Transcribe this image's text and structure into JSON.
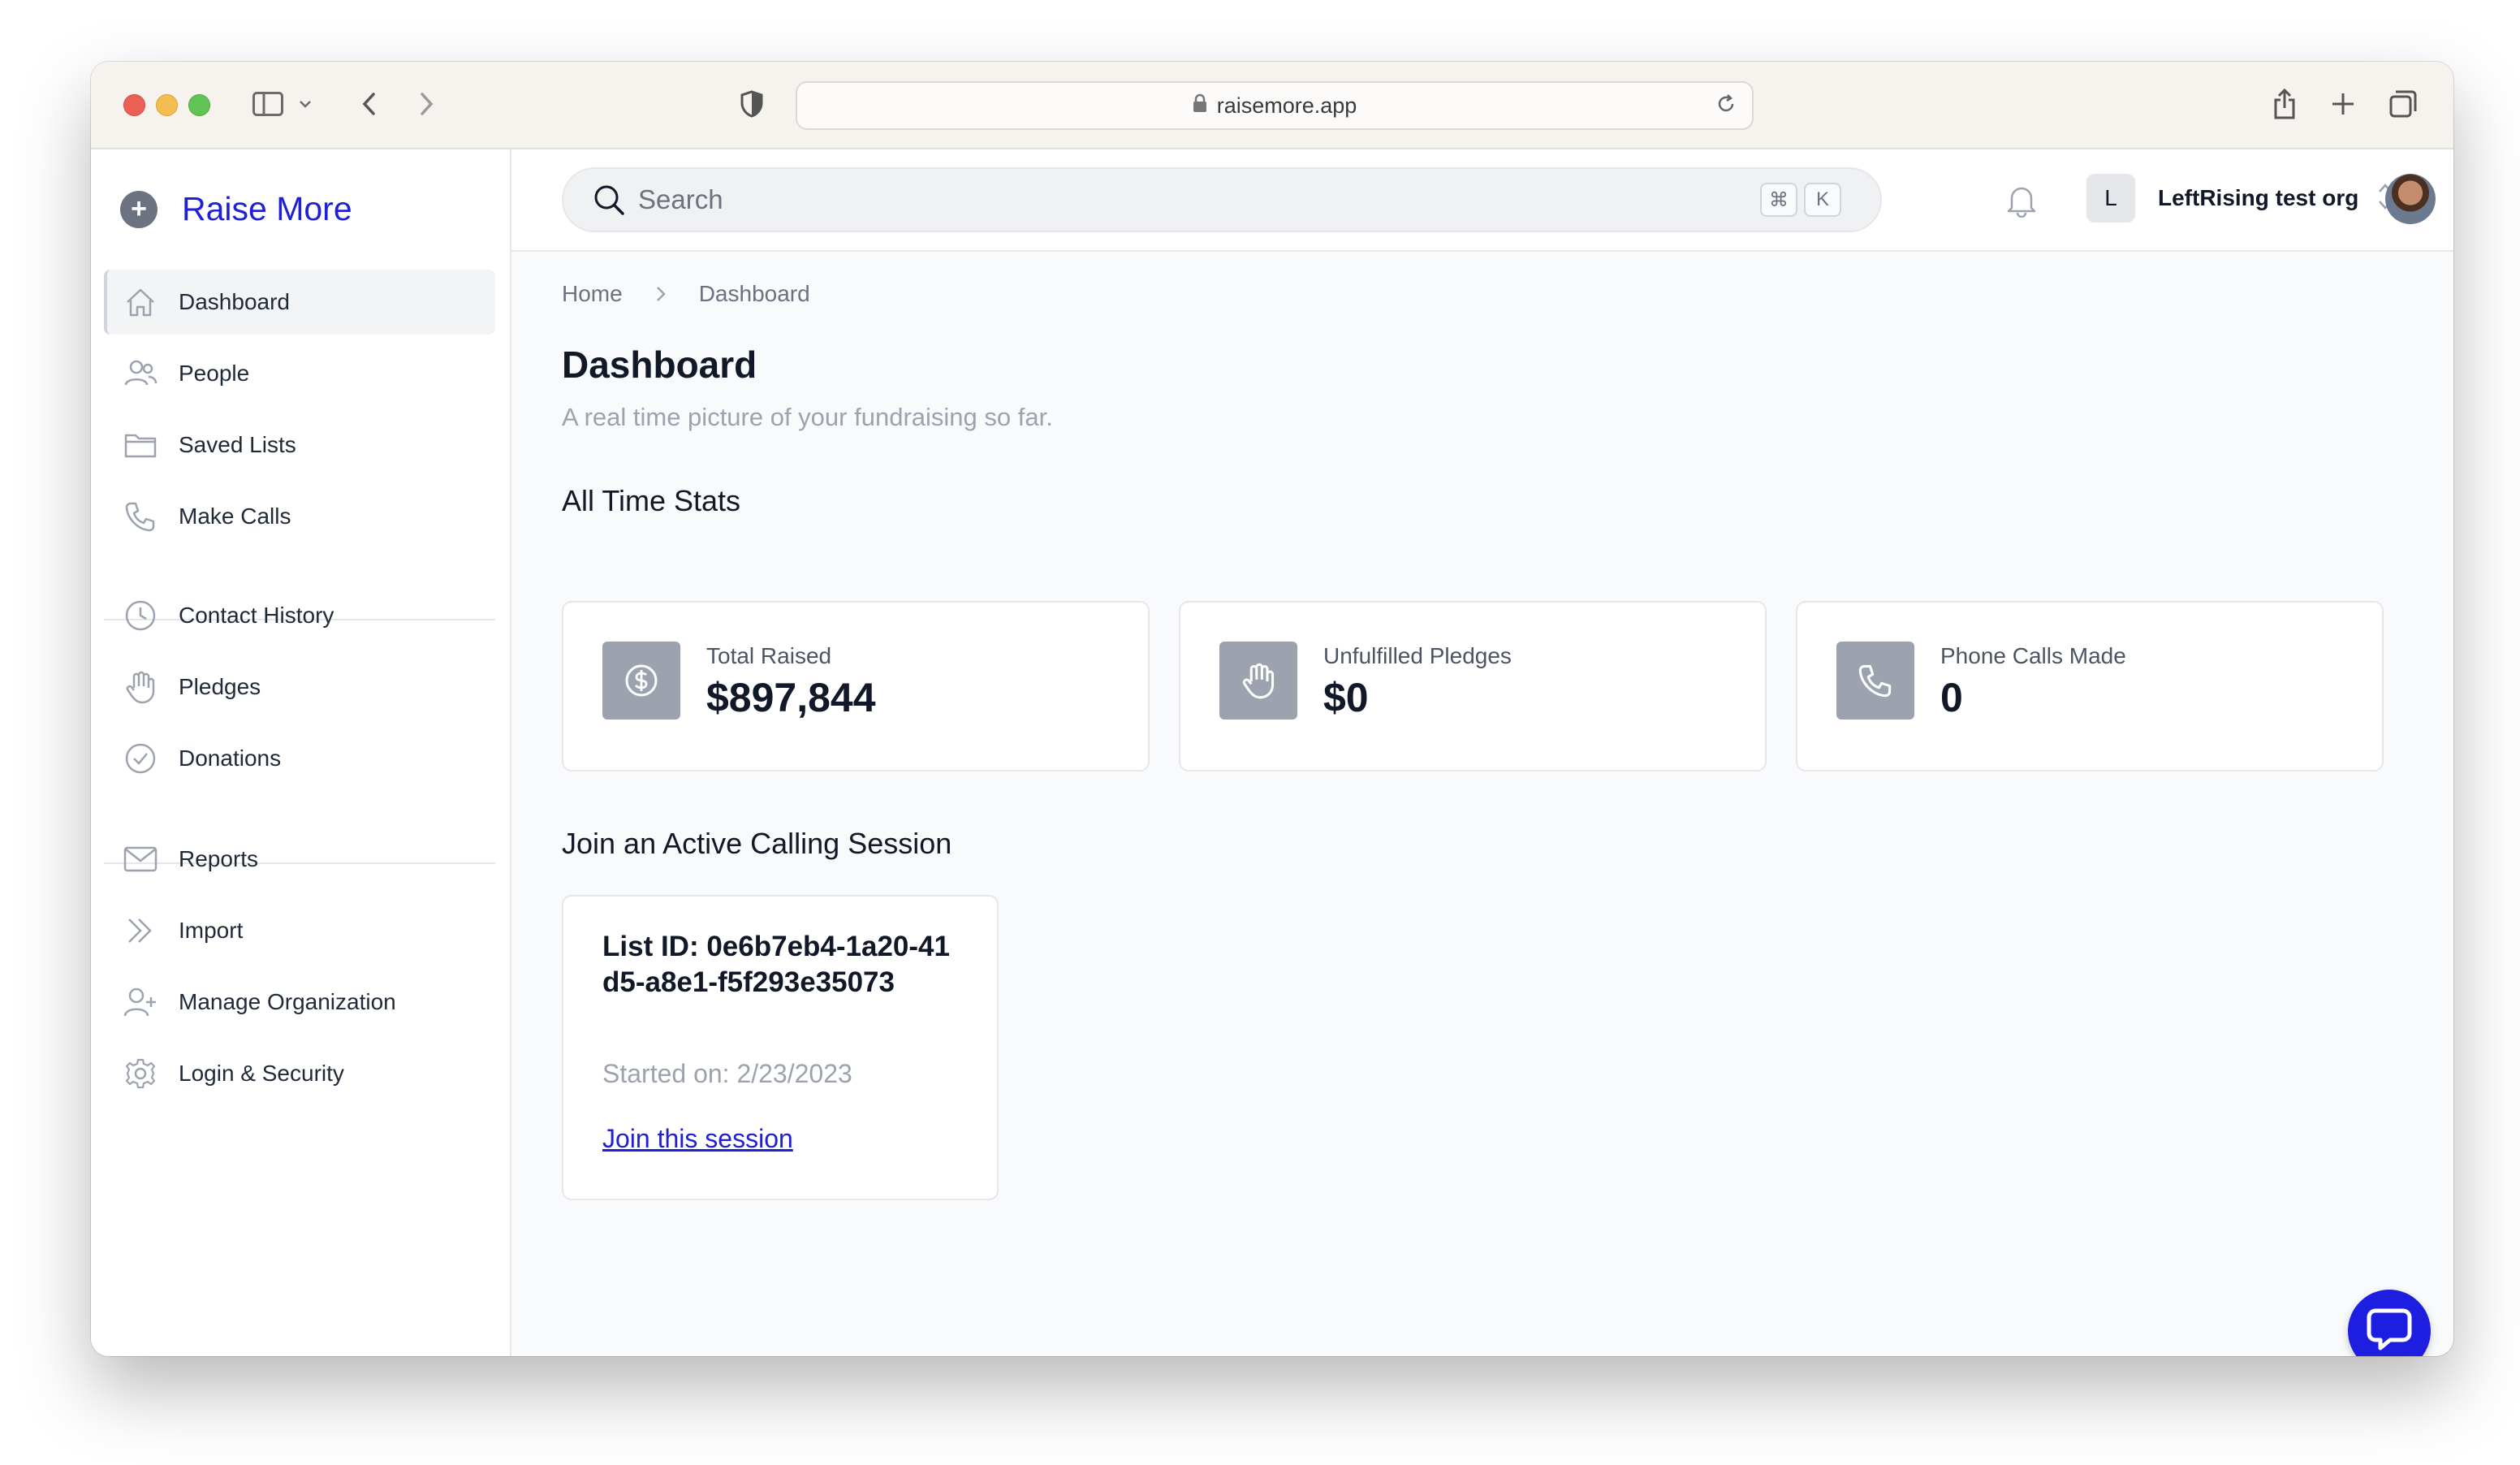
{
  "browser": {
    "url": "raisemore.app"
  },
  "sidebar": {
    "brand": "Raise More",
    "items": [
      {
        "label": "Dashboard",
        "icon": "home-icon",
        "active": true
      },
      {
        "label": "People",
        "icon": "people-icon"
      },
      {
        "label": "Saved Lists",
        "icon": "folder-icon"
      },
      {
        "label": "Make Calls",
        "icon": "phone-icon"
      },
      {
        "label": "Contact History",
        "icon": "clock-icon"
      },
      {
        "label": "Pledges",
        "icon": "hand-icon"
      },
      {
        "label": "Donations",
        "icon": "check-circle-icon"
      },
      {
        "label": "Reports",
        "icon": "envelope-icon"
      },
      {
        "label": "Import",
        "icon": "chevrons-right-icon"
      },
      {
        "label": "Manage Organization",
        "icon": "user-plus-icon"
      },
      {
        "label": "Login & Security",
        "icon": "gear-icon"
      }
    ]
  },
  "topbar": {
    "search_placeholder": "Search",
    "shortcut_keys": [
      "⌘",
      "K"
    ],
    "org_initial": "L",
    "org_name": "LeftRising test org"
  },
  "breadcrumb": [
    "Home",
    "Dashboard"
  ],
  "page": {
    "title": "Dashboard",
    "subtitle": "A real time picture of your fundraising so far."
  },
  "stats": {
    "heading": "All Time Stats",
    "cards": [
      {
        "label": "Total Raised",
        "value": "$897,844",
        "icon": "dollar-icon"
      },
      {
        "label": "Unfulfilled Pledges",
        "value": "$0",
        "icon": "hand-icon"
      },
      {
        "label": "Phone Calls Made",
        "value": "0",
        "icon": "phone-icon"
      }
    ]
  },
  "sessions": {
    "heading": "Join an Active Calling Session",
    "items": [
      {
        "list_id": "List ID: 0e6b7eb4-1a20-41d5-a8e1-f5f293e35073",
        "started": "Started on: 2/23/2023",
        "join_label": "Join this session"
      }
    ]
  },
  "colors": {
    "brand": "#1f1fd6",
    "chat_button": "#1d1ee0"
  }
}
